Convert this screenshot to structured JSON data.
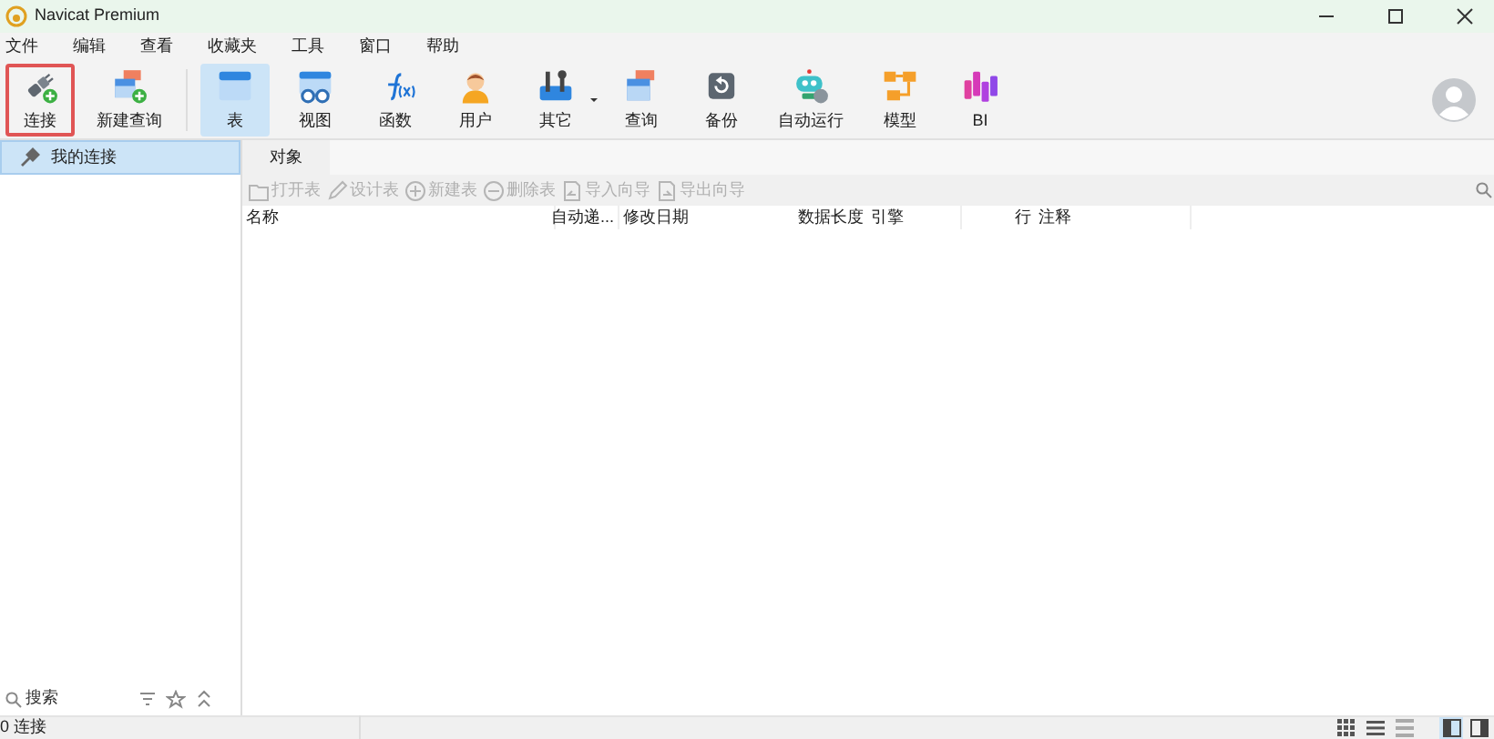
{
  "window": {
    "title": "Navicat Premium"
  },
  "menu": [
    "文件",
    "编辑",
    "查看",
    "收藏夹",
    "工具",
    "窗口",
    "帮助"
  ],
  "toolbar": [
    {
      "kind": "connect",
      "label": "连接",
      "selected": false,
      "focused": true
    },
    {
      "kind": "new-query",
      "label": "新建查询",
      "selected": false,
      "focused": false
    },
    {
      "kind": "table",
      "label": "表",
      "selected": true,
      "focused": false
    },
    {
      "kind": "view",
      "label": "视图",
      "selected": false,
      "focused": false
    },
    {
      "kind": "function",
      "label": "函数",
      "selected": false,
      "focused": false
    },
    {
      "kind": "user",
      "label": "用户",
      "selected": false,
      "focused": false
    },
    {
      "kind": "other",
      "label": "其它",
      "selected": false,
      "focused": false
    },
    {
      "kind": "query",
      "label": "查询",
      "selected": false,
      "focused": false
    },
    {
      "kind": "backup",
      "label": "备份",
      "selected": false,
      "focused": false
    },
    {
      "kind": "automation",
      "label": "自动运行",
      "selected": false,
      "focused": false
    },
    {
      "kind": "model",
      "label": "模型",
      "selected": false,
      "focused": false
    },
    {
      "kind": "bi",
      "label": "BI",
      "selected": false,
      "focused": false
    }
  ],
  "sidebar": {
    "items": [
      {
        "label": "我的连接",
        "selected": true
      }
    ],
    "search": {
      "placeholder": "搜索"
    }
  },
  "tabs": [
    {
      "label": "对象",
      "selected": true
    }
  ],
  "object_toolbar": [
    {
      "kind": "open",
      "label": "打开表",
      "disabled": true
    },
    {
      "kind": "design",
      "label": "设计表",
      "disabled": true
    },
    {
      "kind": "new",
      "label": "新建表",
      "disabled": true
    },
    {
      "kind": "delete",
      "label": "删除表",
      "disabled": true
    },
    {
      "kind": "import",
      "label": "导入向导",
      "disabled": true
    },
    {
      "kind": "export",
      "label": "导出向导",
      "disabled": true
    }
  ],
  "table": {
    "columns": [
      {
        "label": "名称"
      },
      {
        "label": "自动递..."
      },
      {
        "label": "修改日期"
      },
      {
        "label": "数据长度"
      },
      {
        "label": "引擎"
      },
      {
        "label": "行"
      },
      {
        "label": "注释"
      }
    ]
  },
  "status_bar": {
    "text": "0 连接",
    "views": [
      {
        "kind": "grid",
        "selected": false
      },
      {
        "kind": "list",
        "selected": false
      },
      {
        "kind": "detail",
        "selected": false
      }
    ],
    "panels": [
      {
        "kind": "left",
        "selected": true
      },
      {
        "kind": "right",
        "selected": false
      }
    ]
  }
}
